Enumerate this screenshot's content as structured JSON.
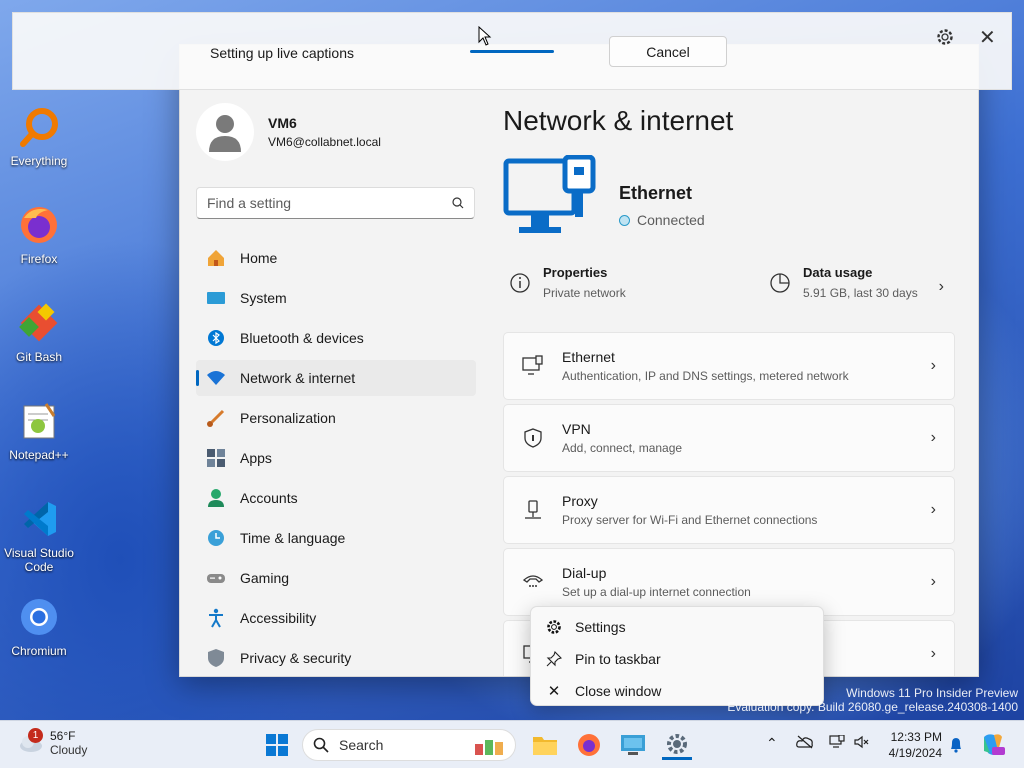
{
  "desktop": {
    "icons": [
      {
        "label": "Everything"
      },
      {
        "label": "Firefox"
      },
      {
        "label": "Git Bash"
      },
      {
        "label": "Notepad++"
      },
      {
        "label": "Visual Studio Code"
      },
      {
        "label": "Chromium"
      }
    ],
    "watermark_line1": "Windows 11 Pro Insider Preview",
    "watermark_line2": "Evaluation copy. Build 26080.ge_release.240308-1400"
  },
  "live_captions": {
    "status_text": "Setting up live captions",
    "cancel_label": "Cancel",
    "progress": 0.25
  },
  "settings": {
    "user": {
      "name": "VM6",
      "email": "VM6@collabnet.local"
    },
    "search_placeholder": "Find a setting",
    "nav": [
      {
        "label": "Home",
        "icon": "home-icon"
      },
      {
        "label": "System",
        "icon": "system-icon"
      },
      {
        "label": "Bluetooth & devices",
        "icon": "bluetooth-icon"
      },
      {
        "label": "Network & internet",
        "icon": "wifi-icon",
        "active": true
      },
      {
        "label": "Personalization",
        "icon": "brush-icon"
      },
      {
        "label": "Apps",
        "icon": "apps-icon"
      },
      {
        "label": "Accounts",
        "icon": "accounts-icon"
      },
      {
        "label": "Time & language",
        "icon": "time-icon"
      },
      {
        "label": "Gaming",
        "icon": "gaming-icon"
      },
      {
        "label": "Accessibility",
        "icon": "accessibility-icon"
      },
      {
        "label": "Privacy & security",
        "icon": "shield-icon"
      }
    ],
    "page_title": "Network & internet",
    "connection": {
      "name": "Ethernet",
      "status": "Connected"
    },
    "properties": {
      "title": "Properties",
      "sub": "Private network"
    },
    "data_usage": {
      "title": "Data usage",
      "sub": "5.91 GB, last 30 days"
    },
    "cards": [
      {
        "title": "Ethernet",
        "sub": "Authentication, IP and DNS settings, metered network",
        "icon": "ethernet-icon"
      },
      {
        "title": "VPN",
        "sub": "Add, connect, manage",
        "icon": "vpn-shield-icon"
      },
      {
        "title": "Proxy",
        "sub": "Proxy server for Wi-Fi and Ethernet connections",
        "icon": "proxy-icon"
      },
      {
        "title": "Dial-up",
        "sub": "Set up a dial-up internet connection",
        "icon": "dialup-icon"
      }
    ]
  },
  "context_menu": {
    "items": [
      {
        "label": "Settings",
        "icon": "gear-icon"
      },
      {
        "label": "Pin to taskbar",
        "icon": "pin-icon"
      },
      {
        "label": "Close window",
        "icon": "close-icon"
      }
    ]
  },
  "taskbar": {
    "weather_temp": "56°F",
    "weather_desc": "Cloudy",
    "weather_badge": "1",
    "search_label": "Search",
    "time": "12:33 PM",
    "date": "4/19/2024"
  },
  "colors": {
    "accent": "#0067c0"
  }
}
